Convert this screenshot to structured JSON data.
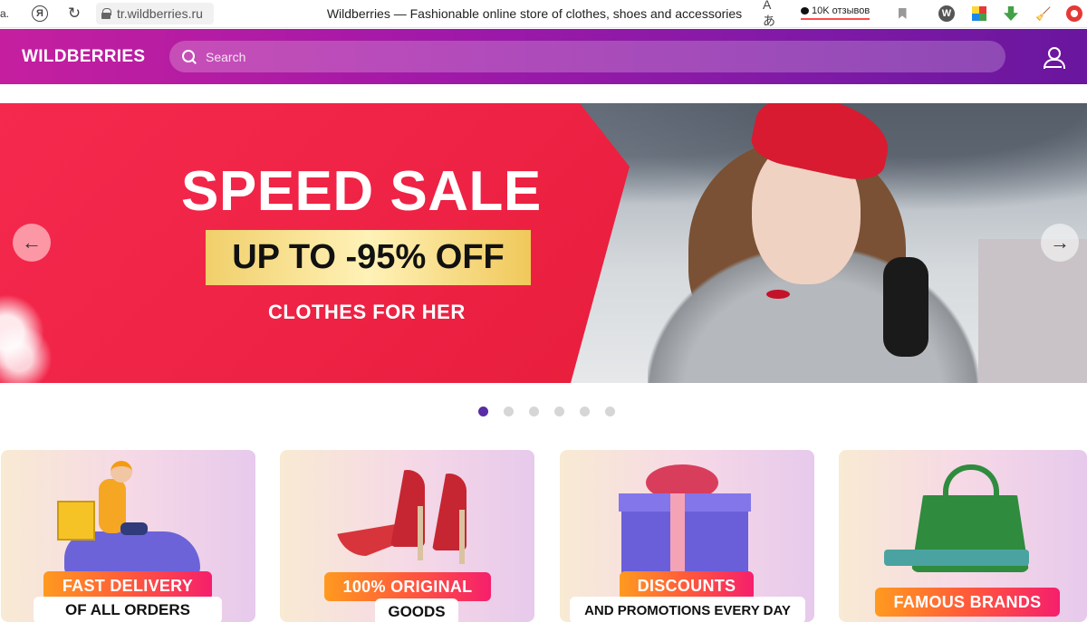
{
  "browser": {
    "back_stub": "а.",
    "y_button": "Я",
    "url": "tr.wildberries.ru",
    "page_title": "Wildberries — Fashionable online store of clothes, shoes and accessories",
    "translate_icon": "Aあ",
    "reviews_label": "10K отзывов",
    "ext_w": "W",
    "ext_broom": "🧹"
  },
  "header": {
    "logo": "WILDBERRIES",
    "search_placeholder": "Search"
  },
  "banner": {
    "headline": "SPEED SALE",
    "promo": "UP TO -95% OFF",
    "subline": "CLOTHES FOR HER",
    "prev_arrow": "←",
    "next_arrow": "→",
    "slide_count": 6,
    "active_slide": 1
  },
  "cards": [
    {
      "title": "FAST DELIVERY",
      "subtitle": "OF ALL ORDERS"
    },
    {
      "title": "100% ORIGINAL",
      "subtitle": "GOODS"
    },
    {
      "title": "DISCOUNTS",
      "subtitle": "AND PROMOTIONS EVERY DAY"
    },
    {
      "title": "FAMOUS BRANDS",
      "subtitle": ""
    }
  ],
  "colors": {
    "header_gradient_start": "#c51f9f",
    "header_gradient_end": "#6a169e",
    "banner_red": "#f5294d",
    "active_dot": "#5a2ca6",
    "pill_start": "#ff9a1f",
    "pill_end": "#f51f6c"
  }
}
